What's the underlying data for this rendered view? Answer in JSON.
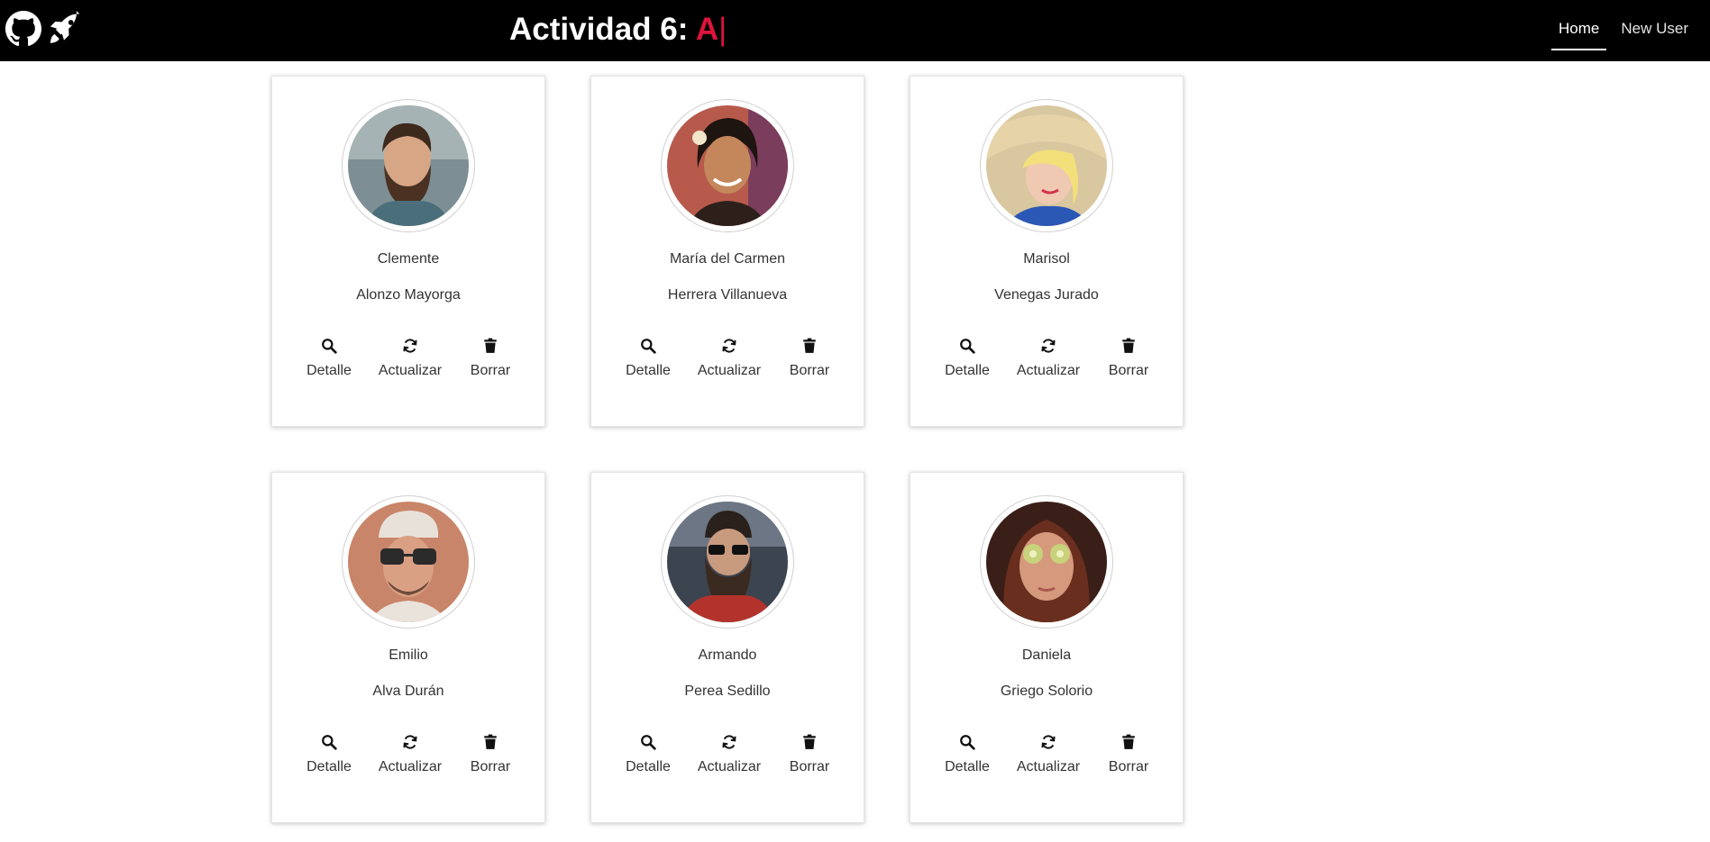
{
  "navbar": {
    "title_prefix": "Actividad 6: ",
    "title_typed": "A",
    "title_cursor": "|",
    "links": [
      {
        "label": "Home",
        "active": true
      },
      {
        "label": "New User",
        "active": false
      }
    ],
    "accent_color": "#dc143c",
    "icons": [
      "github-icon",
      "rocket-icon"
    ]
  },
  "actions": {
    "detalle": "Detalle",
    "actualizar": "Actualizar",
    "borrar": "Borrar"
  },
  "users": [
    {
      "first_name": "Clemente",
      "last_name": "Alonzo Mayorga"
    },
    {
      "first_name": "María del Carmen",
      "last_name": "Herrera Villanueva"
    },
    {
      "first_name": "Marisol",
      "last_name": "Venegas Jurado"
    },
    {
      "first_name": "Emilio",
      "last_name": "Alva Durán"
    },
    {
      "first_name": "Armando",
      "last_name": "Perea Sedillo"
    },
    {
      "first_name": "Daniela",
      "last_name": "Griego Solorio"
    }
  ]
}
